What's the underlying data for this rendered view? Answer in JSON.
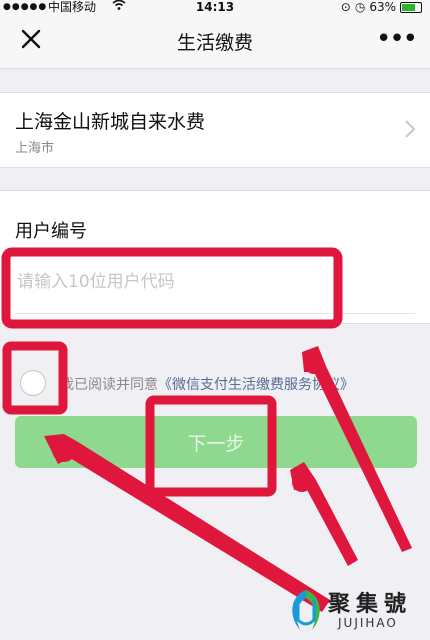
{
  "status_bar": {
    "carrier": "中国移动",
    "time": "14:13",
    "battery": "63%"
  },
  "nav": {
    "title": "生活缴费",
    "close_icon": "close-icon",
    "more_icon": "more-dots-icon",
    "more_label": "•••"
  },
  "provider": {
    "name": "上海金山新城自来水费",
    "city": "上海市"
  },
  "account": {
    "label": "用户编号",
    "placeholder": "请输入10位用户代码",
    "value": ""
  },
  "agreement": {
    "text": "我已阅读并同意",
    "link": "《微信支付生活缴费服务协议》",
    "checked": false
  },
  "next_button": {
    "label": "下一步"
  },
  "watermark": {
    "brand": "聚集號",
    "sub": "JUJIHAO"
  },
  "colors": {
    "accent_green": "#8fd88f",
    "annotation_red": "#e0173c",
    "link_blue": "#576b95"
  }
}
